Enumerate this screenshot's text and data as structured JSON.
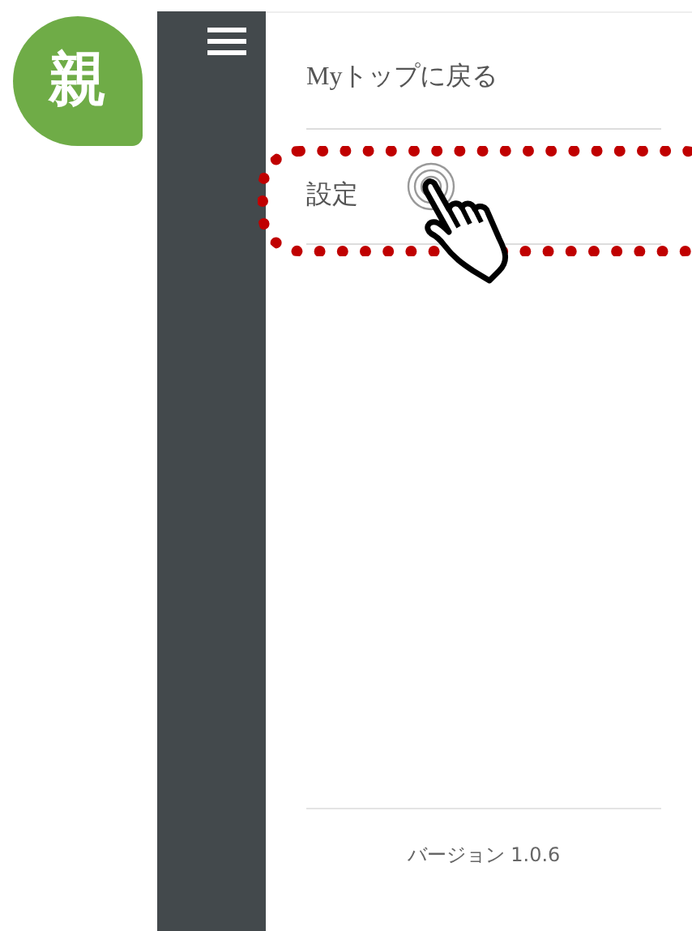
{
  "badge": {
    "label": "親"
  },
  "menu": {
    "items": [
      {
        "label": "Myトップに戻る",
        "highlighted": false
      },
      {
        "label": "設定",
        "highlighted": true
      }
    ]
  },
  "footer": {
    "version": "バージョン 1.0.6"
  }
}
